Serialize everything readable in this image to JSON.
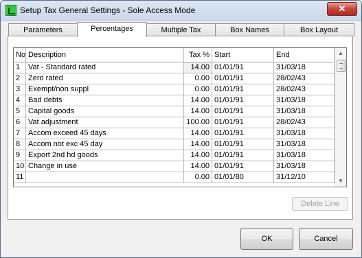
{
  "window": {
    "title": "Setup Tax General Settings - Sole Access Mode",
    "close_glyph": "✕"
  },
  "tabs": [
    {
      "label": "Parameters",
      "active": false
    },
    {
      "label": "Percentages",
      "active": true
    },
    {
      "label": "Multiple Tax",
      "active": false
    },
    {
      "label": "Box Names",
      "active": false
    },
    {
      "label": "Box Layout",
      "active": false
    }
  ],
  "grid": {
    "columns": {
      "no": "No",
      "description": "Description",
      "tax": "Tax %",
      "start": "Start",
      "end": "End"
    },
    "rows": [
      {
        "no": "1",
        "description": "Vat - Standard rated",
        "tax": "14.00",
        "start": "01/01/91",
        "end": "31/03/18"
      },
      {
        "no": "2",
        "description": "Zero rated",
        "tax": "0.00",
        "start": "01/01/91",
        "end": "28/02/43"
      },
      {
        "no": "3",
        "description": "Exempt/non suppl",
        "tax": "0.00",
        "start": "01/01/91",
        "end": "28/02/43"
      },
      {
        "no": "4",
        "description": "Bad debts",
        "tax": "14.00",
        "start": "01/01/91",
        "end": "31/03/18"
      },
      {
        "no": "5",
        "description": "Capital goods",
        "tax": "14.00",
        "start": "01/01/91",
        "end": "31/03/18"
      },
      {
        "no": "6",
        "description": "Vat adjustment",
        "tax": "100.00",
        "start": "01/01/91",
        "end": "28/02/43"
      },
      {
        "no": "7",
        "description": "Accom exceed 45 days",
        "tax": "14.00",
        "start": "01/01/91",
        "end": "31/03/18"
      },
      {
        "no": "8",
        "description": "Accom not exc 45 day",
        "tax": "14.00",
        "start": "01/01/91",
        "end": "31/03/18"
      },
      {
        "no": "9",
        "description": "Export 2nd hd goods",
        "tax": "14.00",
        "start": "01/01/91",
        "end": "31/03/18"
      },
      {
        "no": "10",
        "description": "Change in use",
        "tax": "14.00",
        "start": "01/01/91",
        "end": "31/03/18"
      },
      {
        "no": "11",
        "description": "",
        "tax": "0.00",
        "start": "01/01/80",
        "end": "31/12/10"
      }
    ]
  },
  "scroll": {
    "up_glyph": "▲",
    "down_glyph": "▼"
  },
  "buttons": {
    "delete_line": "Delete Line",
    "ok": "OK",
    "cancel": "Cancel"
  }
}
